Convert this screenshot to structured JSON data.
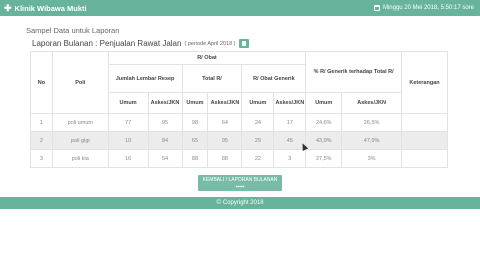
{
  "header": {
    "brand_icon": "plus-icon",
    "brand": "Klinik Wibawa Mukti",
    "calendar_icon": "calendar-icon",
    "datetime": "Minggu 20 Mei 2018, 5:50:17 sore"
  },
  "page": {
    "title": "Sampel Data untuk Laporan",
    "report_title": "Laporan Bulanan : Penjualan Rawat Jalan",
    "period": "( periode April 2018 )",
    "print_icon": "print-icon"
  },
  "table": {
    "h_no": "No",
    "h_poli": "Poli",
    "h_obat": "R/ Obat",
    "h_lembar": "Jumlah Lembar Resep",
    "h_total": "Total R/",
    "h_generik": "R/ Obat Generik",
    "h_persen": "% R/ Generik terhadap Total R/",
    "h_ket": "Keterangan",
    "h_umum": "Umum",
    "h_askes": "Askes/JKN",
    "rows": [
      {
        "no": "1",
        "poli": "poli umum",
        "lr_umum": "77",
        "lr_askes": "95",
        "tr_umum": "98",
        "tr_askes": "64",
        "gen_umum": "24",
        "gen_askes": "17",
        "p_umum": "24,6%",
        "p_askes": "26,5%",
        "ket": ""
      },
      {
        "no": "2",
        "poli": "poli gigi",
        "lr_umum": "10",
        "lr_askes": "84",
        "tr_umum": "65",
        "tr_askes": "95",
        "gen_umum": "29",
        "gen_askes": "45",
        "p_umum": "43,9%",
        "p_askes": "47,9%",
        "ket": ""
      },
      {
        "no": "3",
        "poli": "poli kia",
        "lr_umum": "16",
        "lr_askes": "54",
        "tr_umum": "88",
        "tr_askes": "88",
        "gen_umum": "22",
        "gen_askes": "3",
        "p_umum": "27,5%",
        "p_askes": "3%",
        "ket": ""
      }
    ]
  },
  "bottom_button": {
    "line1": "KEMBALI / LAPORAN BULANAN",
    "line2": "▪▪▪▪▪"
  },
  "footer": {
    "copyright_icon": "copyright-icon",
    "text": "Copyright 2018"
  }
}
